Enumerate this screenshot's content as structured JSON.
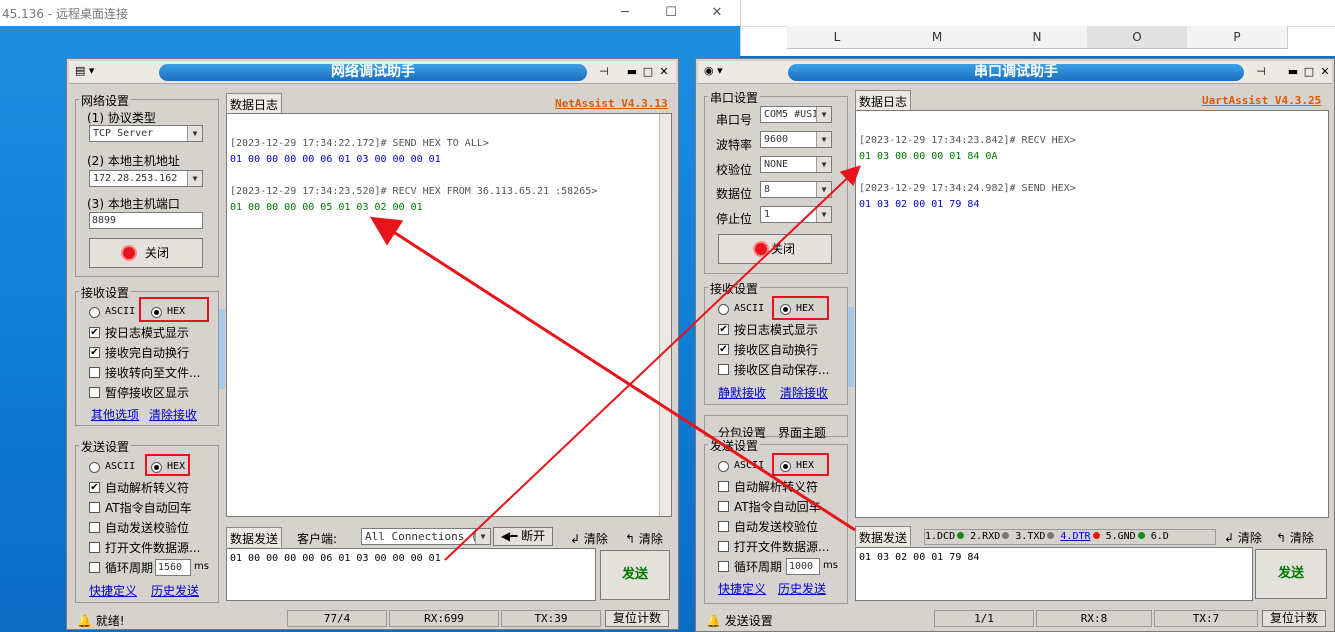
{
  "rdp": {
    "title": "45.136 - 远程桌面连接",
    "min": "─",
    "max": "☐",
    "close": "✕"
  },
  "excel": {
    "cols": [
      "L",
      "M",
      "N",
      "O",
      "P"
    ]
  },
  "net": {
    "title": "网络调试助手",
    "version": "NetAssist V4.3.13",
    "net_settings": "网络设置",
    "proto_label": "(1) 协议类型",
    "proto_value": "TCP Server",
    "host_label": "(2) 本地主机地址",
    "host_value": "172.28.253.162",
    "port_label": "(3) 本地主机端口",
    "port_value": "8899",
    "close_btn": "关闭",
    "recv_settings": "接收设置",
    "ascii": "ASCII",
    "hex": "HEX",
    "recv_opt1": "按日志模式显示",
    "recv_opt2": "接收完自动换行",
    "recv_opt3": "接收转向至文件...",
    "recv_opt4": "暂停接收区显示",
    "other_opts": "其他选项",
    "clear_recv": "清除接收",
    "send_settings": "发送设置",
    "send_opt1": "自动解析转义符",
    "send_opt2": "AT指令自动回车",
    "send_opt3": "自动发送校验位",
    "send_opt4": "打开文件数据源...",
    "send_opt5": "循环周期",
    "period_value": "1560",
    "ms": "ms",
    "shortcut": "快捷定义",
    "history": "历史发送",
    "log_tab": "数据日志",
    "log": [
      {
        "text": "[2023-12-29 17:34:22.172]# SEND HEX TO ALL>",
        "color": "#555555"
      },
      {
        "text": "01 00 00 00 00 06 01 03 00 00 00 01",
        "color": "#0000cc"
      },
      {
        "text": "",
        "color": "#000000"
      },
      {
        "text": "[2023-12-29 17:34:23.520]# RECV HEX FROM 36.113.65.21 :58265>",
        "color": "#555555"
      },
      {
        "text": "01 00 00 00 00 05 01 03 02 00 01",
        "color": "#007700"
      }
    ],
    "send_tab": "数据发送",
    "client_label": "客户端:",
    "client_value": "All Connections (",
    "disconnect": "断开",
    "clear1": "清除",
    "clear2": "清除",
    "send_text": "01 00 00 00 00 06 01 03 00 00 00 01",
    "send_btn": "发送",
    "status_ready": "就绪!",
    "status_count": "77/4",
    "status_rx": "RX:699",
    "status_tx": "TX:39",
    "reset": "复位计数"
  },
  "uart": {
    "title": "串口调试助手",
    "version": "UartAssist V4.3.25",
    "port_settings": "串口设置",
    "port_label": "串口号",
    "port_value": "COM5 #USI",
    "baud_label": "波特率",
    "baud_value": "9600",
    "parity_label": "校验位",
    "parity_value": "NONE",
    "data_label": "数据位",
    "data_value": "8",
    "stop_label": "停止位",
    "stop_value": "1",
    "close_btn": "关闭",
    "recv_settings": "接收设置",
    "ascii": "ASCII",
    "hex": "HEX",
    "recv_opt1": "按日志模式显示",
    "recv_opt2": "接收区自动换行",
    "recv_opt3": "接收区自动保存...",
    "silent_recv": "静默接收",
    "clear_recv": "清除接收",
    "tab_a": "分包设置",
    "tab_b": "界面主题",
    "send_settings": "发送设置",
    "send_opt1": "自动解析转义符",
    "send_opt2": "AT指令自动回车",
    "send_opt3": "自动发送校验位",
    "send_opt4": "打开文件数据源...",
    "send_opt5": "循环周期",
    "period_value": "1000",
    "ms": "ms",
    "shortcut": "快捷定义",
    "history": "历史发送",
    "log_tab": "数据日志",
    "log": [
      {
        "text": "[2023-12-29 17:34:23.842]# RECV HEX>",
        "color": "#555555"
      },
      {
        "text": "01 03 00 00 00 01 84 0A",
        "color": "#007700"
      },
      {
        "text": "",
        "color": "#000000"
      },
      {
        "text": "[2023-12-29 17:34:24.982]# SEND HEX>",
        "color": "#555555"
      },
      {
        "text": "01 03 02 00 01 79 84",
        "color": "#0000cc"
      }
    ],
    "send_tab": "数据发送",
    "pins": [
      "1.DCD",
      "2.RXD",
      "3.TXD",
      "4.DTR",
      "5.GND",
      "6.D"
    ],
    "clear1": "清除",
    "clear2": "清除",
    "send_text": "01 03 02 00 01 79 84",
    "send_btn": "发送",
    "status_ready": "发送设置",
    "status_count": "1/1",
    "status_rx": "RX:8",
    "status_tx": "TX:7",
    "reset": "复位计数"
  },
  "colors": {
    "accent_red": "#e8141b",
    "version_orange": "#e05a00",
    "send_green": "#007700",
    "recv_blue": "#0000cc"
  }
}
